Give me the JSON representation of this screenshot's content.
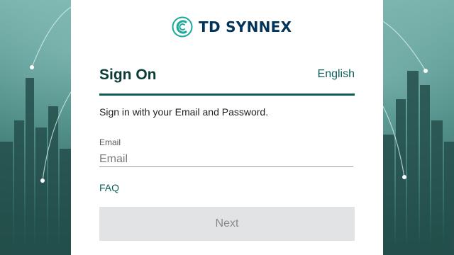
{
  "brand": {
    "name": "TD SYNNEX",
    "accent": "#0c5f59",
    "logo_color": "#1aa89a"
  },
  "signin": {
    "title": "Sign On",
    "language": "English",
    "subtitle": "Sign in with your Email and Password.",
    "email_label": "Email",
    "email_placeholder": "Email",
    "email_value": "",
    "faq_label": "FAQ",
    "next_label": "Next"
  }
}
